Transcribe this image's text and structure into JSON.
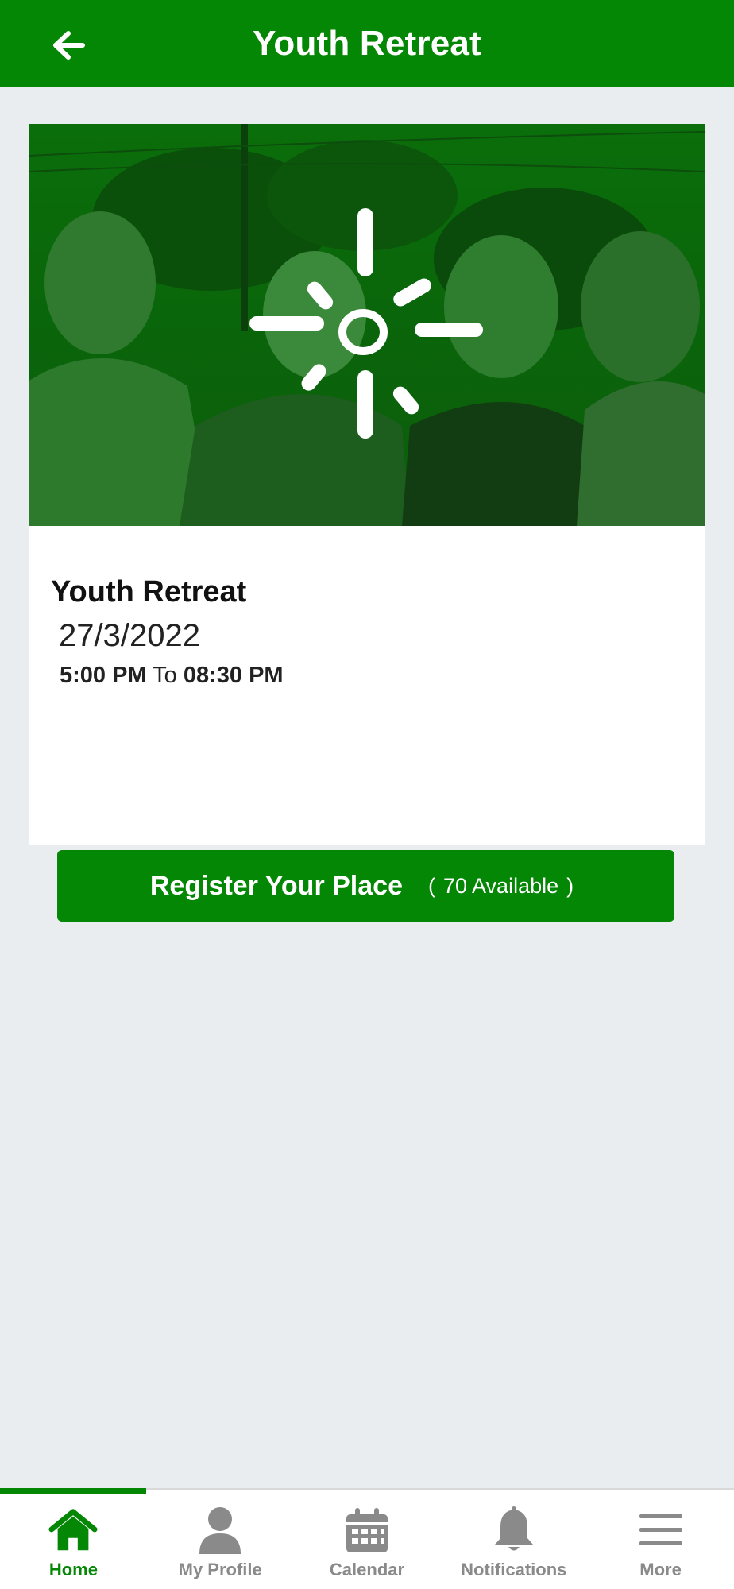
{
  "header": {
    "title": "Youth Retreat",
    "back_icon": "arrow-left-icon"
  },
  "event": {
    "image_alt": "Group photo of retreat attendees with sun logo",
    "title": "Youth Retreat",
    "date": "27/3/2022",
    "time_start": "5:00 PM",
    "time_separator": "To",
    "time_end": "08:30 PM",
    "register": {
      "label": "Register Your Place",
      "available_open": "(",
      "available_text": "70 Available",
      "available_close": ")"
    }
  },
  "bottom_nav": {
    "items": [
      {
        "label": "Home",
        "icon": "home-icon",
        "active": true
      },
      {
        "label": "My Profile",
        "icon": "person-icon",
        "active": false
      },
      {
        "label": "Calendar",
        "icon": "calendar-icon",
        "active": false
      },
      {
        "label": "Notifications",
        "icon": "bell-icon",
        "active": false
      },
      {
        "label": "More",
        "icon": "menu-icon",
        "active": false
      }
    ]
  },
  "colors": {
    "brand_green": "#048704",
    "background": "#eaedef",
    "nav_inactive": "#8a8a8a"
  }
}
